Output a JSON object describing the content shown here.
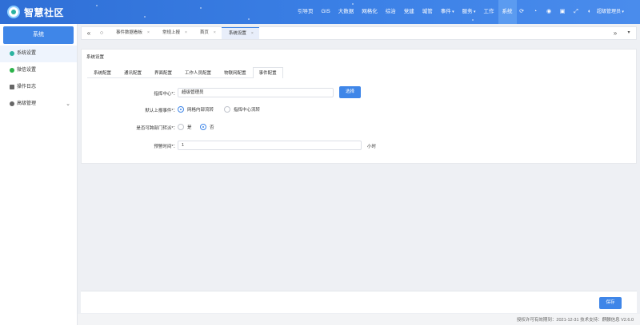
{
  "app": {
    "title": "智慧社区",
    "user": "超级管理员"
  },
  "nav": {
    "items": [
      {
        "label": "引导页",
        "dropdown": false,
        "active": false
      },
      {
        "label": "GIS",
        "dropdown": false,
        "active": false
      },
      {
        "label": "大数据",
        "dropdown": false,
        "active": false
      },
      {
        "label": "网格化",
        "dropdown": false,
        "active": false
      },
      {
        "label": "综治",
        "dropdown": false,
        "active": false
      },
      {
        "label": "党建",
        "dropdown": false,
        "active": false
      },
      {
        "label": "城管",
        "dropdown": false,
        "active": false
      },
      {
        "label": "事件",
        "dropdown": true,
        "active": false
      },
      {
        "label": "服务",
        "dropdown": true,
        "active": false
      },
      {
        "label": "工作",
        "dropdown": false,
        "active": false
      },
      {
        "label": "系统",
        "dropdown": false,
        "active": true
      }
    ],
    "icons": [
      "refresh-icon",
      "notification-icon",
      "eye-icon",
      "lock-icon",
      "fullscreen-icon",
      "theme-icon"
    ]
  },
  "sidebar": {
    "header": "系统",
    "items": [
      {
        "label": "系统设置",
        "icon": "settings-icon",
        "color": "#2bb3a0",
        "active": true
      },
      {
        "label": "微信设置",
        "icon": "wechat-icon",
        "color": "#2bb34a",
        "active": false
      },
      {
        "label": "操作日志",
        "icon": "log-icon",
        "color": "#555555",
        "active": false
      },
      {
        "label": "高级管理",
        "icon": "admin-icon",
        "color": "#555555",
        "active": false
      }
    ]
  },
  "tabstrip": {
    "tabs": [
      {
        "label": "事件数据看板",
        "active": false
      },
      {
        "label": "常规上报",
        "active": false
      },
      {
        "label": "首页",
        "active": false
      },
      {
        "label": "系统设置",
        "active": true
      }
    ]
  },
  "panel": {
    "title": "系统设置",
    "subtabs": [
      {
        "label": "系统配置",
        "active": false
      },
      {
        "label": "通讯配置",
        "active": false
      },
      {
        "label": "界面配置",
        "active": false
      },
      {
        "label": "工作人员配置",
        "active": false
      },
      {
        "label": "物联网配置",
        "active": false
      },
      {
        "label": "事件配置",
        "active": true
      }
    ],
    "form": {
      "dispatch_center": {
        "label": "指挥中心*：",
        "value": "超级管理员",
        "button": "选择"
      },
      "default_report": {
        "label": "默认上报事件*：",
        "options": [
          {
            "label": "网格内部流转",
            "checked": true
          },
          {
            "label": "指挥中心流转",
            "checked": false
          }
        ]
      },
      "dept_transfer": {
        "label": "是否可跨部门转派*：",
        "options": [
          {
            "label": "是",
            "checked": false
          },
          {
            "label": "否",
            "checked": true
          }
        ]
      },
      "warning_time": {
        "label": "预警时间*：",
        "value": "1",
        "unit": "小时"
      }
    }
  },
  "footer": {
    "save_label": "保存",
    "license": "授权许可有效期到：2021-12-31  技术支持：麒麟信息  V2.6.0"
  },
  "colors": {
    "primary": "#3f86e8",
    "topbar": "#3b80e6"
  }
}
